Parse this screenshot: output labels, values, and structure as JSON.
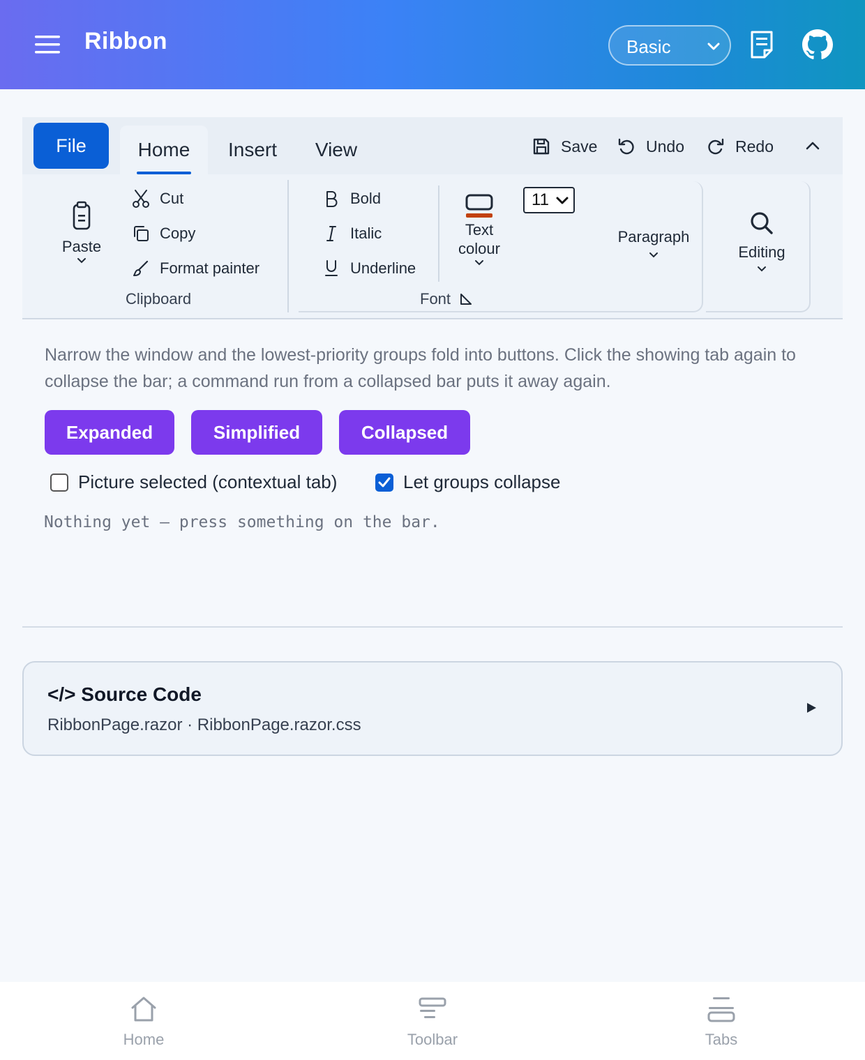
{
  "header": {
    "title": "Ribbon",
    "mode_select": "Basic",
    "icons": [
      "menu-icon",
      "chevron-down-icon",
      "docs-icon",
      "github-icon"
    ]
  },
  "ribbon": {
    "file_label": "File",
    "tabs": [
      {
        "label": "Home",
        "active": true
      },
      {
        "label": "Insert",
        "active": false
      },
      {
        "label": "View",
        "active": false
      }
    ],
    "quick_access": {
      "save": "Save",
      "undo": "Undo",
      "redo": "Redo"
    },
    "clipboard": {
      "paste": "Paste",
      "cut": "Cut",
      "copy": "Copy",
      "format_painter": "Format painter",
      "label": "Clipboard"
    },
    "font": {
      "bold": "Bold",
      "italic": "Italic",
      "underline": "Underline",
      "text_colour_line1": "Text",
      "text_colour_line2": "colour",
      "size": "11",
      "label": "Font",
      "text_colour_swatch": "#c2410c"
    },
    "paragraph": "Paragraph",
    "editing": "Editing"
  },
  "content": {
    "description": "Narrow the window and the lowest-priority groups fold into buttons. Click the showing tab again to collapse the bar; a command run from a collapsed bar puts it away again.",
    "modes": [
      "Expanded",
      "Simplified",
      "Collapsed"
    ],
    "checkbox_contextual": {
      "label": "Picture selected (contextual tab)",
      "checked": false
    },
    "checkbox_collapse": {
      "label": "Let groups collapse",
      "checked": true
    },
    "log": "Nothing yet — press something on the bar."
  },
  "source": {
    "title": "</> Source Code",
    "files": "RibbonPage.razor · RibbonPage.razor.css"
  },
  "bottom_nav": [
    {
      "label": "Home",
      "icon": "home-icon"
    },
    {
      "label": "Toolbar",
      "icon": "toolbar-icon"
    },
    {
      "label": "Tabs",
      "icon": "tabs-icon"
    }
  ],
  "colors": {
    "accent": "#0a5fd6",
    "mode_button": "#7c3aed",
    "header_gradient_start": "#6a6cf0",
    "header_gradient_end": "#0f95c0"
  }
}
